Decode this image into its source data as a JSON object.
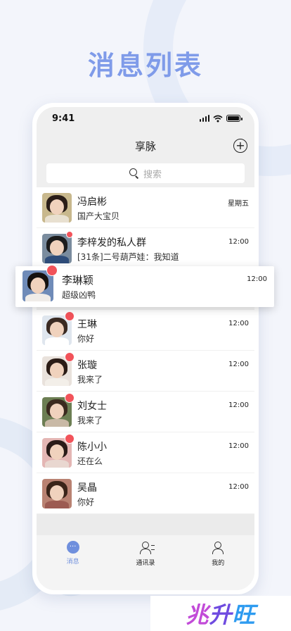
{
  "page": {
    "heading": "消息列表"
  },
  "status_bar": {
    "time": "9:41"
  },
  "nav": {
    "title": "享脉"
  },
  "search": {
    "placeholder": "搜索"
  },
  "chats": [
    {
      "name": "冯启彬",
      "message": "国产大宝贝",
      "time": "星期五",
      "unread_dot": false,
      "avatar_colors": {
        "bg": "#c8b88d",
        "hair": "#2a1d18",
        "body": "#e8e0d0"
      }
    },
    {
      "name": "李梓发的私人群",
      "message": "[31条]二号葫芦娃：我知道",
      "time": "12:00",
      "unread_dot": true,
      "avatar_colors": {
        "bg": "#7a8c9e",
        "hair": "#1c1c1c",
        "body": "#2f4d7a"
      }
    },
    {
      "name": "王琳",
      "message": "你好",
      "time": "12:00",
      "unread_dot": true,
      "avatar_colors": {
        "bg": "#dfe6ee",
        "hair": "#3a2a22",
        "body": "#ffffff"
      }
    },
    {
      "name": "张璇",
      "message": "我来了",
      "time": "12:00",
      "unread_dot": true,
      "avatar_colors": {
        "bg": "#e9e2dc",
        "hair": "#2b1c16",
        "body": "#f3efe9"
      }
    },
    {
      "name": "刘女士",
      "message": "我来了",
      "time": "12:00",
      "unread_dot": true,
      "avatar_colors": {
        "bg": "#6c7e53",
        "hair": "#3b2a1f",
        "body": "#c9b9a6"
      }
    },
    {
      "name": "陈小小",
      "message": "还在么",
      "time": "12:00",
      "unread_dot": true,
      "avatar_colors": {
        "bg": "#e4b6b4",
        "hair": "#2a1b18",
        "body": "#e9d7d0"
      }
    },
    {
      "name": "吴晶",
      "message": "你好",
      "time": "12:00",
      "unread_dot": false,
      "avatar_colors": {
        "bg": "#b98272",
        "hair": "#3a2419",
        "body": "#9c5b52"
      }
    }
  ],
  "floating_chat": {
    "name": "李琳颖",
    "message": "超级凶鸭",
    "time": "12:00",
    "unread_dot": true,
    "avatar_colors": {
      "bg": "#6f8bb8",
      "hair": "#15110f",
      "body": "#f0ece8"
    }
  },
  "tabs": [
    {
      "label": "消息",
      "icon": "message-icon",
      "active": true
    },
    {
      "label": "通讯录",
      "icon": "contacts-icon",
      "active": false
    },
    {
      "label": "我的",
      "icon": "profile-icon",
      "active": false
    }
  ],
  "brand": {
    "text1": "兆",
    "text2": "升",
    "text3": "旺"
  },
  "colors": {
    "accent": "#6f8fdd",
    "badge": "#f2535a",
    "heading": "#7f9be9"
  }
}
